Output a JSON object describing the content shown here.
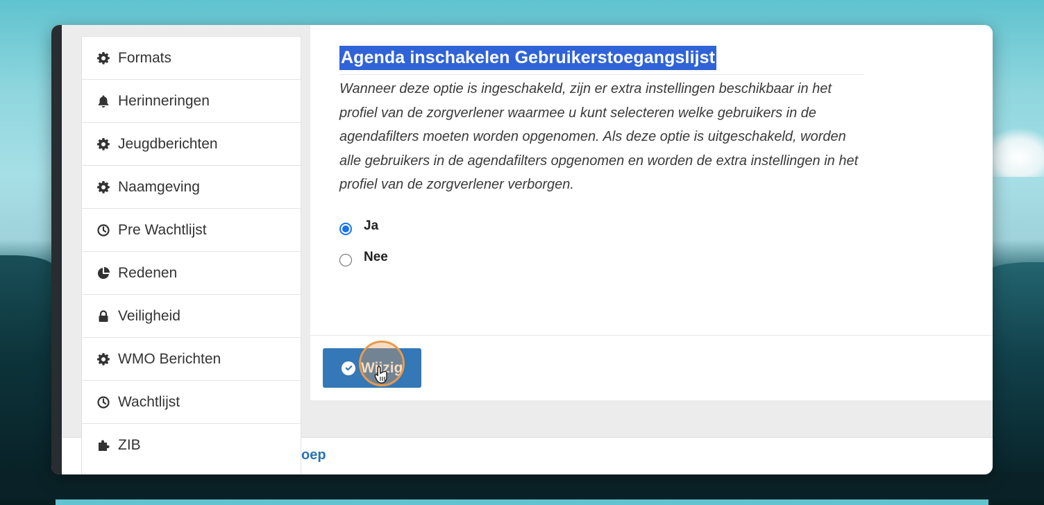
{
  "sidebar": {
    "items": [
      {
        "label": "Formats",
        "icon": "gear-icon"
      },
      {
        "label": "Herinneringen",
        "icon": "bell-icon"
      },
      {
        "label": "Jeugdberichten",
        "icon": "gear-icon"
      },
      {
        "label": "Naamgeving",
        "icon": "gear-icon"
      },
      {
        "label": "Pre Wachtlijst",
        "icon": "clock-icon"
      },
      {
        "label": "Redenen",
        "icon": "pie-chart-icon"
      },
      {
        "label": "Veiligheid",
        "icon": "lock-icon"
      },
      {
        "label": "WMO Berichten",
        "icon": "gear-icon"
      },
      {
        "label": "Wachtlijst",
        "icon": "clock-icon"
      },
      {
        "label": "ZIB",
        "icon": "puzzle-icon"
      }
    ]
  },
  "setting": {
    "title": "Agenda inschakelen Gebruikerstoegangslijst",
    "description": "Wanneer deze optie is ingeschakeld, zijn er extra instellingen beschikbaar in het profiel van de zorgverlener waarmee u kunt selecteren welke gebruikers in de agendafilters moeten worden opgenomen. Als deze optie is uitgeschakeld, worden alle gebruikers in de agendafilters opgenomen en worden de extra instellingen in het profiel van de zorgverlener verborgen.",
    "options": [
      {
        "label": "Ja",
        "checked": true
      },
      {
        "label": "Nee",
        "checked": false
      }
    ]
  },
  "actions": {
    "submit_label": "Wijzig"
  },
  "footer": {
    "link_fragment": "oep"
  },
  "colors": {
    "accent": "#3478b8",
    "title_highlight": "#2f63d7",
    "radio_checked": "#1a73e8"
  }
}
